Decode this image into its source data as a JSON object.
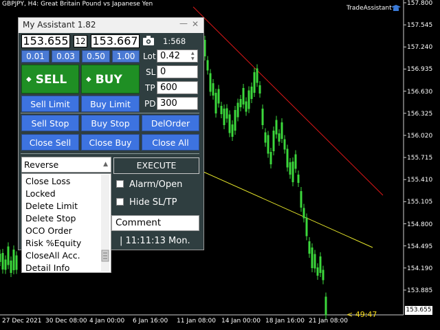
{
  "chart": {
    "title": "GBPJPY, H4:  Great Britain Pound vs Japanese Yen",
    "ta_label": "TradeAssistant",
    "ta_icon": "graduation-cap-icon",
    "current_price": "153.655",
    "timer": "< 49:47",
    "price_ticks": [
      "157.800",
      "157.545",
      "157.240",
      "156.935",
      "156.630",
      "156.325",
      "156.020",
      "155.715",
      "155.410",
      "155.105",
      "154.800",
      "154.495",
      "154.190",
      "153.885"
    ],
    "time_ticks": [
      "27 Dec 2021",
      "30 Dec 08:00",
      "4 Jan 00:00",
      "6 Jan 16:00",
      "11 Jan 08:00",
      "14 Jan 00:00",
      "18 Jan 16:00",
      "21 Jan 08:00"
    ],
    "colors": {
      "candle": "#3cd83c",
      "red_line": "#e01818",
      "yellow_line": "#e8e82a"
    }
  },
  "panel": {
    "title": "My Assistant 1.82",
    "bid": "153.655",
    "spread": "12",
    "ask": "153.667",
    "camera_icon": "camera-icon",
    "ratio": "1:568",
    "quick_lots": [
      "0.01",
      "0.03",
      "0.50",
      "1.00"
    ],
    "sell_label": "SELL",
    "buy_label": "BUY",
    "lot_label": "Lot",
    "lot_value": "0.42",
    "sl_label": "SL",
    "sl_value": "0",
    "tp_label": "TP",
    "tp_value": "600",
    "pd_label": "PD",
    "pd_value": "300",
    "sell_limit": "Sell Limit",
    "buy_limit": "Buy Limit",
    "sell_stop": "Sell Stop",
    "buy_stop": "Buy Stop",
    "del_order": "DelOrder",
    "close_sell": "Close Sell",
    "close_buy": "Close Buy",
    "close_all": "Close All",
    "combo_value": "Reverse",
    "options": [
      "Close Loss",
      "Locked",
      "Delete Limit",
      "Delete Stop",
      "OCO Order",
      "Risk %Equity",
      "CloseAll Acc.",
      "Detail Info"
    ],
    "execute": "EXECUTE",
    "alarm_label": "Alarm/Open",
    "hide_label": "Hide SL/TP",
    "comment": "Comment",
    "clock": "| 11:11:13  Mon.",
    "colors": {
      "trade": "#1f8f24",
      "button": "#3d73e0",
      "panel": "#2f3e40"
    }
  }
}
